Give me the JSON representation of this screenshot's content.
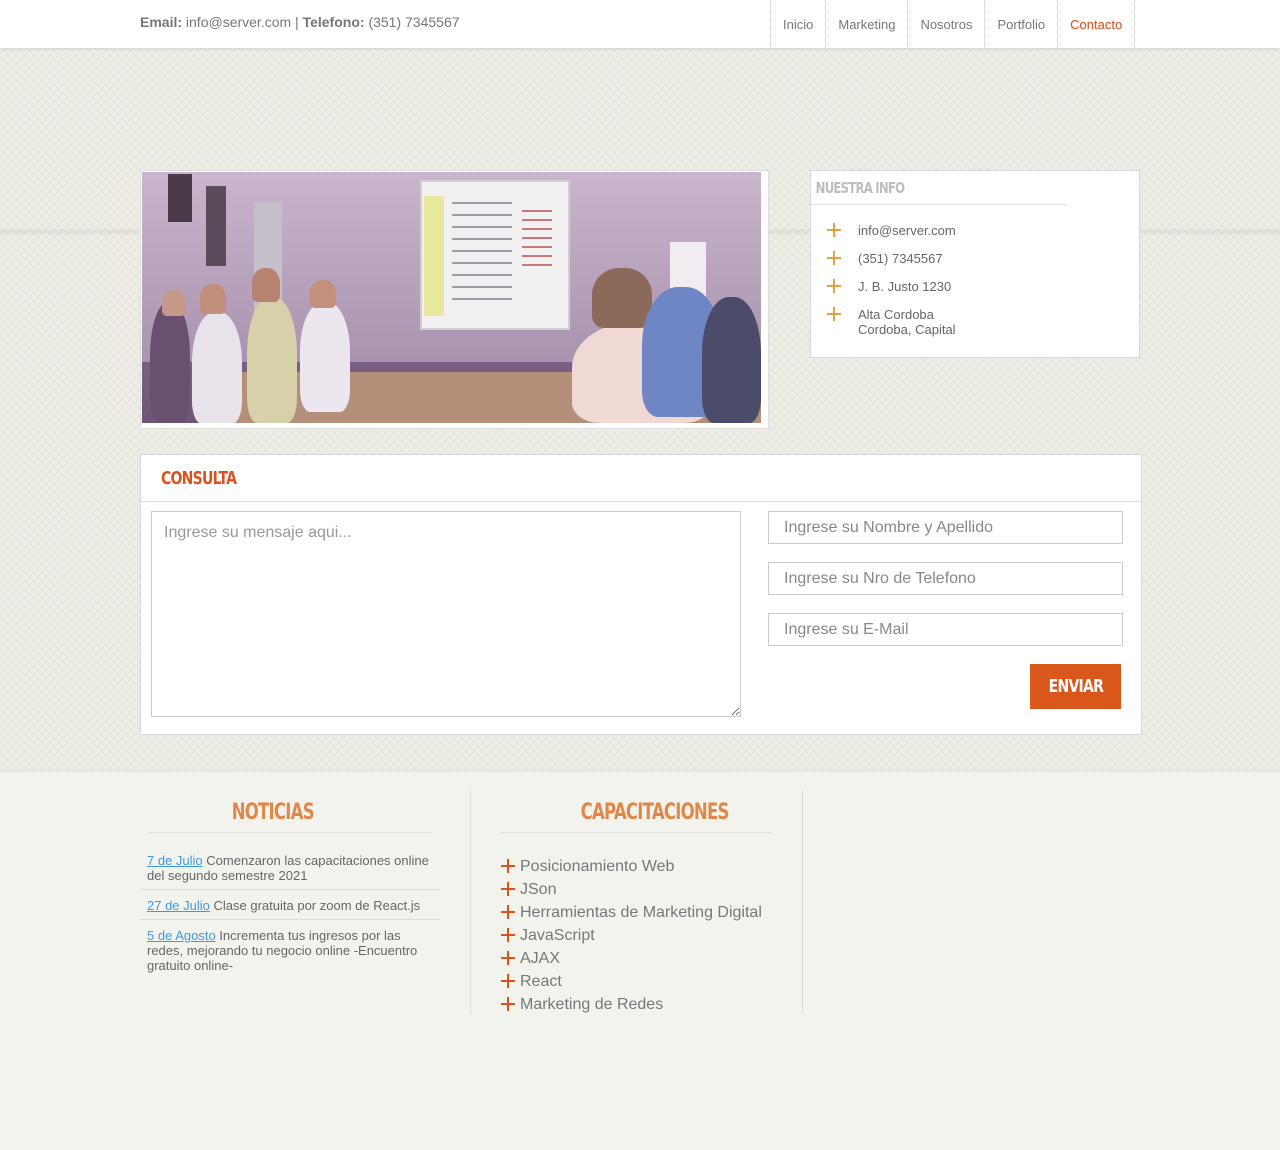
{
  "header": {
    "email_label": "Email:",
    "email_value": "info@server.com",
    "separator": "|",
    "phone_label": "Telefono:",
    "phone_value": "(351) 7345567"
  },
  "nav": {
    "items": [
      {
        "label": "Inicio"
      },
      {
        "label": "Marketing"
      },
      {
        "label": "Nosotros"
      },
      {
        "label": "Portfolio"
      },
      {
        "label": "Contacto",
        "active": true
      }
    ]
  },
  "info": {
    "title": "Nuestra Info",
    "items": [
      {
        "text": "info@server.com"
      },
      {
        "text": "(351) 7345567"
      },
      {
        "text": "J. B. Justo 1230"
      },
      {
        "text": "Alta Cordoba",
        "text2": "Cordoba, Capital"
      }
    ]
  },
  "consulta": {
    "title": "CONSULTA",
    "message_placeholder": "Ingrese su mensaje aqui...",
    "name_placeholder": "Ingrese su Nombre y Apellido",
    "phone_placeholder": "Ingrese su Nro de Telefono",
    "email_placeholder": "Ingrese su E-Mail",
    "send_label": "ENVIAR"
  },
  "noticias": {
    "title": "Noticias",
    "items": [
      {
        "date": "7 de Julio",
        "text": "Comenzaron las capacitaciones online del segundo semestre 2021"
      },
      {
        "date": "27 de Julio",
        "text": "Clase gratuita por zoom de React.js"
      },
      {
        "date": "5 de Agosto",
        "text": "Incrementa tus ingresos por las redes, mejorando tu negocio online -Encuentro gratuito online-"
      }
    ]
  },
  "capacitaciones": {
    "title": "Capacitaciones",
    "items": [
      "Posicionamiento Web",
      "JSon",
      "Herramientas de Marketing Digital",
      "JavaScript",
      "AJAX",
      "React",
      "Marketing de Redes"
    ]
  },
  "colors": {
    "accent": "#d9531e",
    "link": "#3d9be0",
    "bullet": "#e4a13f"
  }
}
